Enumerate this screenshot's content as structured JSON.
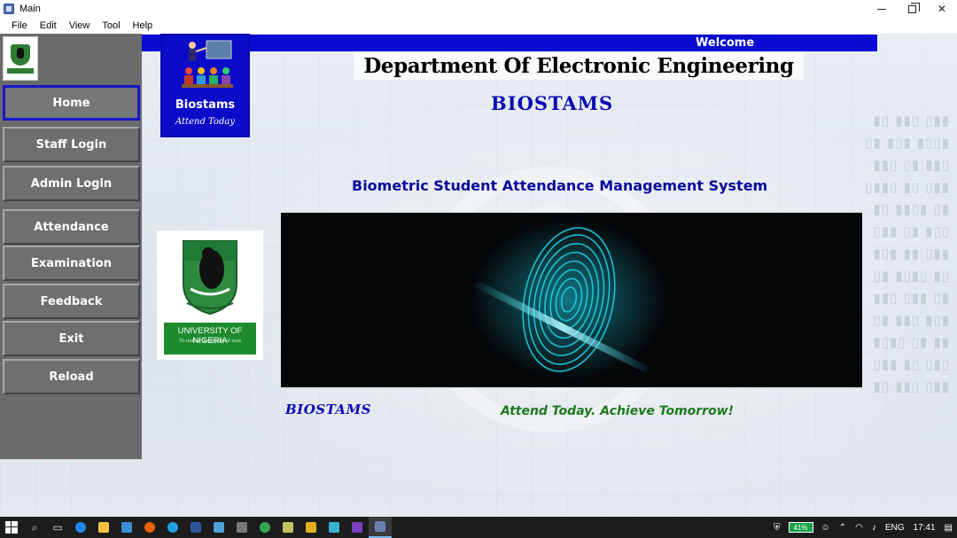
{
  "window": {
    "title": "Main",
    "controls": {
      "minimize": "minimize-icon",
      "maximize": "restore-icon",
      "close": "✕"
    }
  },
  "menu": [
    "File",
    "Edit",
    "View",
    "Tool",
    "Help"
  ],
  "sidebar": {
    "items": [
      {
        "label": "Home",
        "active": true
      },
      {
        "label": "Staff Login"
      },
      {
        "label": "Admin Login"
      },
      {
        "label": "Attendance"
      },
      {
        "label": "Examination"
      },
      {
        "label": "Feedback"
      },
      {
        "label": "Exit"
      },
      {
        "label": "Reload"
      }
    ]
  },
  "header": {
    "welcome": "Welcome",
    "department": "Department Of Electronic Engineering",
    "app_name": "BIOSTAMS",
    "system_name": "Biometric Student Attendance Management System"
  },
  "brand_box": {
    "title": "Biostams",
    "tagline": "Attend Today"
  },
  "university_logo": {
    "name": "UNIVERSITY OF NIGERIA",
    "motto": "To restore the dignity of man"
  },
  "footer": {
    "brand": "BIOSTAMS",
    "slogan": "Attend Today. Achieve Tomorrow!"
  },
  "taskbar": {
    "battery": "41%",
    "language": "ENG",
    "time": "17:41"
  },
  "colors": {
    "accent_blue": "#0a0ad2",
    "sidebar_gray": "#6b6b6b",
    "slogan_green": "#1d7a1d",
    "fingerprint_cyan": "#19d2e6"
  }
}
